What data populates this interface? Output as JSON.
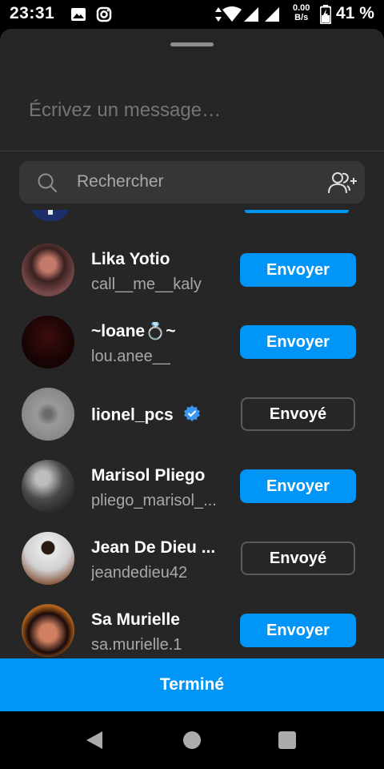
{
  "status_bar": {
    "time": "23:31",
    "speed_value": "0.00",
    "speed_unit": "B/s",
    "battery": "41 %",
    "icons": [
      "gallery-icon",
      "instagram-icon",
      "data-arrows-icon",
      "wifi-icon",
      "signal-icon",
      "signal-icon",
      "battery-charging-icon"
    ]
  },
  "sheet": {
    "message_placeholder": "Écrivez un message…",
    "search_placeholder": "Rechercher"
  },
  "contacts": [
    {
      "name": "Lika Yotio",
      "username": "call__me__kaly",
      "action": "Envoyer",
      "sent": false,
      "verified": false,
      "avatar_color": "#6b3a3a"
    },
    {
      "name": "~loane💍~",
      "username": "lou.anee__",
      "action": "Envoyer",
      "sent": false,
      "verified": false,
      "avatar_color": "#1a0606"
    },
    {
      "name": "lionel_pcs",
      "username": "",
      "action": "Envoyé",
      "sent": true,
      "verified": true,
      "avatar_color": "#8c8c8c"
    },
    {
      "name": "Marisol Pliego",
      "username": "pliego_marisol_...",
      "action": "Envoyer",
      "sent": false,
      "verified": false,
      "avatar_color": "#5a5a5a"
    },
    {
      "name": "Jean De Dieu ...",
      "username": "jeandedieu42",
      "action": "Envoyé",
      "sent": true,
      "verified": false,
      "avatar_color": "#d9d9d9"
    },
    {
      "name": "Sa Murielle",
      "username": "sa.murielle.1",
      "action": "Envoyer",
      "sent": false,
      "verified": false,
      "avatar_color": "#b5651d"
    }
  ],
  "done_label": "Terminé",
  "colors": {
    "accent": "#0095f6",
    "sheet_bg": "#262626",
    "search_bg": "#363636",
    "secondary_text": "#a8a8a8"
  }
}
